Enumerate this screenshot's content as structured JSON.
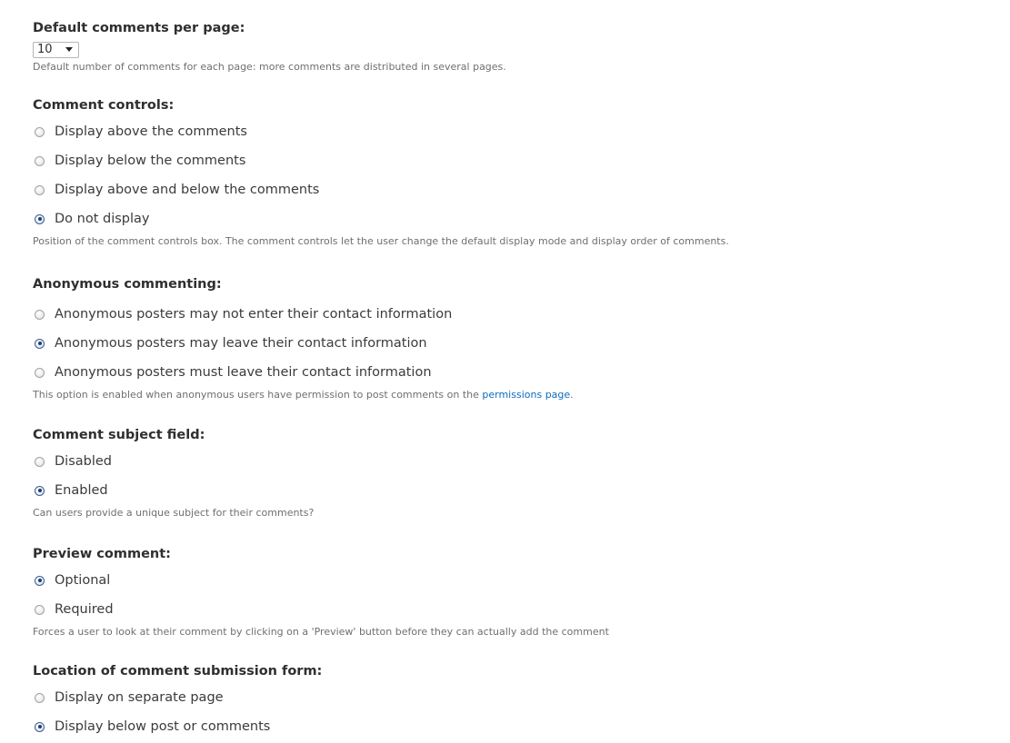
{
  "comments_per_page": {
    "label": "Default comments per page:",
    "selected": "10",
    "description": "Default number of comments for each page: more comments are distributed in several pages."
  },
  "comment_controls": {
    "label": "Comment controls:",
    "options": [
      {
        "label": "Display above the comments",
        "checked": false
      },
      {
        "label": "Display below the comments",
        "checked": false
      },
      {
        "label": "Display above and below the comments",
        "checked": false
      },
      {
        "label": "Do not display",
        "checked": true
      }
    ],
    "description": "Position of the comment controls box. The comment controls let the user change the default display mode and display order of comments."
  },
  "anonymous_commenting": {
    "label": "Anonymous commenting:",
    "options": [
      {
        "label": "Anonymous posters may not enter their contact information",
        "checked": false
      },
      {
        "label": "Anonymous posters may leave their contact information",
        "checked": true
      },
      {
        "label": "Anonymous posters must leave their contact information",
        "checked": false
      }
    ],
    "description_prefix": "This option is enabled when anonymous users have permission to post comments on the ",
    "description_link": "permissions page",
    "description_suffix": "."
  },
  "subject_field": {
    "label": "Comment subject field:",
    "options": [
      {
        "label": "Disabled",
        "checked": false
      },
      {
        "label": "Enabled",
        "checked": true
      }
    ],
    "description": "Can users provide a unique subject for their comments?"
  },
  "preview_comment": {
    "label": "Preview comment:",
    "options": [
      {
        "label": "Optional",
        "checked": true
      },
      {
        "label": "Required",
        "checked": false
      }
    ],
    "description": "Forces a user to look at their comment by clicking on a 'Preview' button before they can actually add the comment"
  },
  "submission_form_location": {
    "label": "Location of comment submission form:",
    "options": [
      {
        "label": "Display on separate page",
        "checked": false
      },
      {
        "label": "Display below post or comments",
        "checked": true
      }
    ]
  }
}
